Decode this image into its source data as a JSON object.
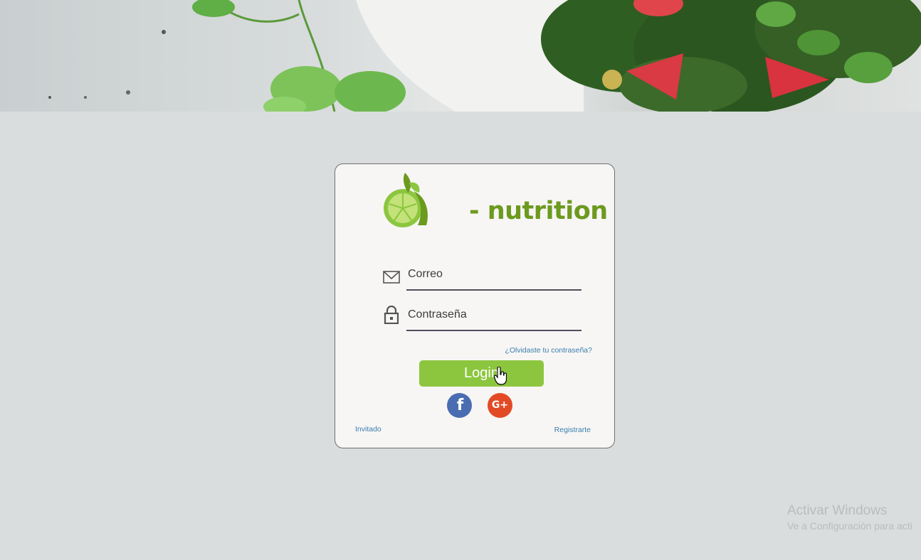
{
  "app": {
    "brand": "- nutrition",
    "colors": {
      "accent": "#8cc63f",
      "brand_text": "#6c9a1f",
      "link": "#3a7dab"
    }
  },
  "hero": {
    "image": "salad-banner-image"
  },
  "login": {
    "email_placeholder": "Correo",
    "email_icon": "envelope-icon",
    "password_placeholder": "Contraseña",
    "password_icon": "lock-icon",
    "forgot_label": "¿Olvidaste tu contraseña?",
    "login_label": "Login",
    "social": {
      "facebook_label": "f",
      "google_label": "G+"
    },
    "guest_label": "Invitado",
    "register_label": "Registrarte"
  },
  "watermark": {
    "title": "Activar Windows",
    "subtitle": "Ve a Configuración para acti"
  }
}
